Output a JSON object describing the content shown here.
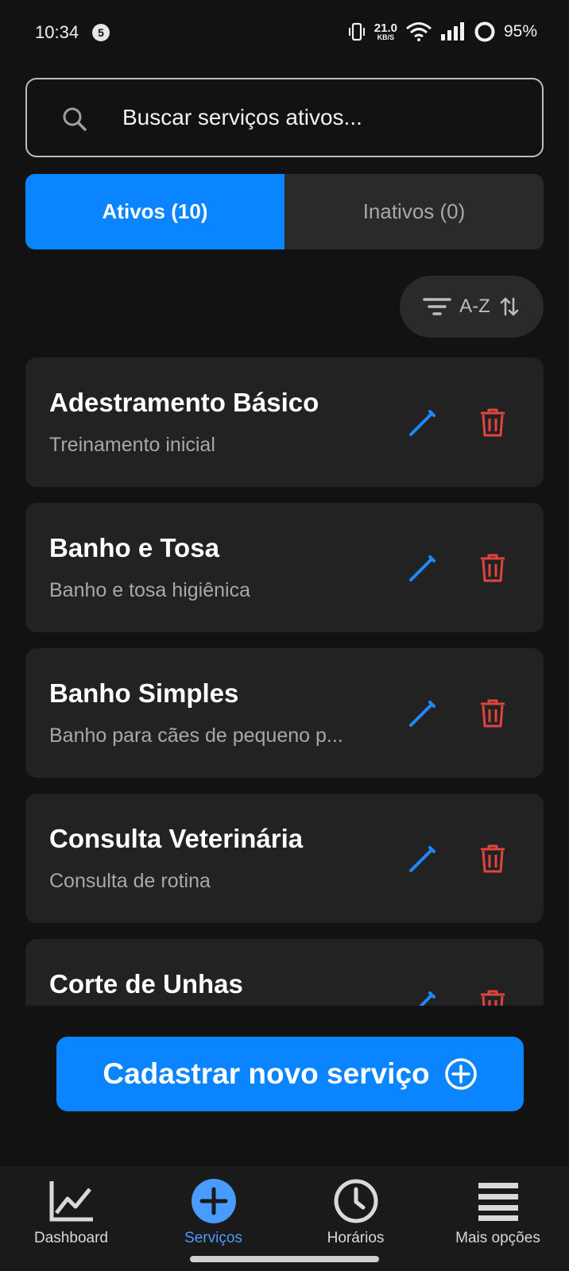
{
  "status_bar": {
    "time": "10:34",
    "notification_count": "5",
    "net_speed_value": "21.0",
    "net_speed_unit": "KB/S",
    "battery": "95%"
  },
  "search": {
    "placeholder": "Buscar serviços ativos...",
    "value": ""
  },
  "tabs": [
    {
      "label": "Ativos (10)",
      "active": true
    },
    {
      "label": "Inativos (0)",
      "active": false
    }
  ],
  "sort": {
    "label": "A-Z"
  },
  "services": [
    {
      "title": "Adestramento Básico",
      "description": "Treinamento inicial"
    },
    {
      "title": "Banho e Tosa",
      "description": "Banho e tosa higiênica"
    },
    {
      "title": "Banho Simples",
      "description": "Banho para cães de pequeno p..."
    },
    {
      "title": "Consulta Veterinária",
      "description": "Consulta de rotina"
    },
    {
      "title": "Corte de Unhas",
      "description": ""
    }
  ],
  "cta": {
    "label": "Cadastrar novo serviço"
  },
  "bottom_nav": [
    {
      "label": "Dashboard",
      "icon": "chart-line-icon"
    },
    {
      "label": "Serviços",
      "icon": "plus-circle-icon",
      "active": true
    },
    {
      "label": "Horários",
      "icon": "clock-icon"
    },
    {
      "label": "Mais opções",
      "icon": "menu-icon"
    }
  ],
  "colors": {
    "accent": "#0a84ff",
    "background": "#121212",
    "card": "#222222",
    "delete": "#e0443e"
  }
}
